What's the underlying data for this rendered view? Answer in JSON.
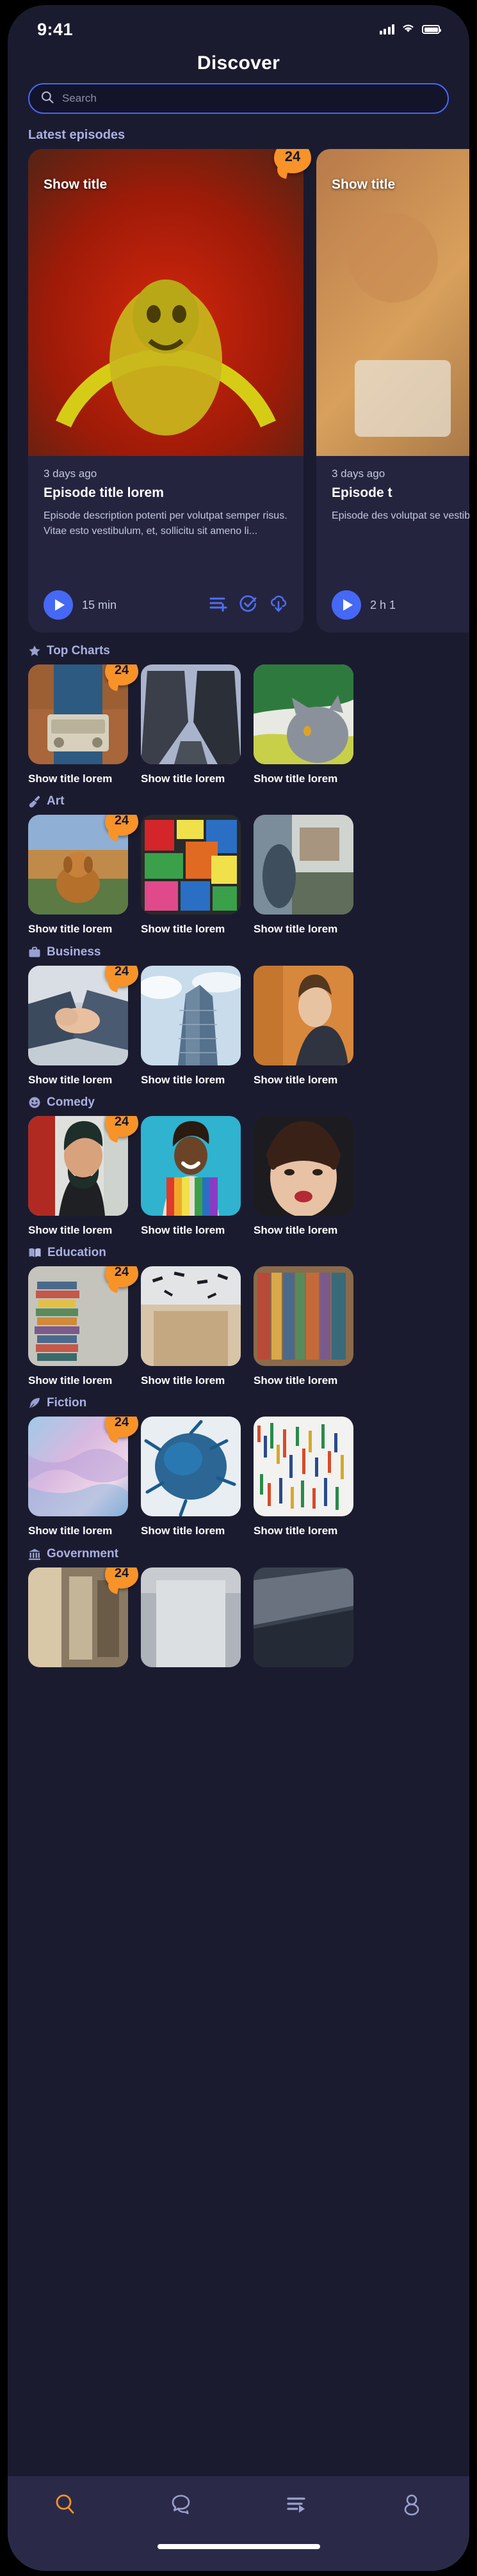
{
  "status_bar": {
    "time": "9:41",
    "icons": [
      "cellular-signal-icon",
      "wifi-icon",
      "battery-icon"
    ]
  },
  "header": {
    "title": "Discover"
  },
  "search": {
    "placeholder": "Search",
    "value": "",
    "icon": "search-icon",
    "border_color": "#4568f5"
  },
  "theme": {
    "background": "#1b1b30",
    "card_background": "#24243f",
    "accent_blue": "#4568f5",
    "accent_orange": "#f79328",
    "heading_color": "#aab0e0",
    "text_primary": "#ffffff",
    "text_secondary": "#c3c7de",
    "tabbar_background": "#2a2a48"
  },
  "latest_episodes": {
    "heading": "Latest episodes",
    "cards": [
      {
        "show_title": "Show title",
        "badge": "24",
        "date": "3 days ago",
        "episode_title": "Episode title lorem",
        "description": "Episode description potenti per volutpat semper risus. Vitae esto vestibulum, et, sollicitu sit ameno li...",
        "duration": "15 min",
        "actions": [
          "add-to-queue-icon",
          "mark-played-icon",
          "download-icon"
        ]
      },
      {
        "show_title": "Show title",
        "badge": "",
        "date": "3 days ago",
        "episode_title": "Episode t",
        "description": "Episode des volutpat se vestibulum,",
        "duration": "2 h 1",
        "actions": []
      }
    ]
  },
  "sections": [
    {
      "heading": "Top Charts",
      "icon": "star-icon",
      "items": [
        {
          "title": "Show title lorem",
          "badge": "24"
        },
        {
          "title": "Show title lorem",
          "badge": ""
        },
        {
          "title": "Show title lorem",
          "badge": ""
        }
      ]
    },
    {
      "heading": "Art",
      "icon": "paintbrush-icon",
      "items": [
        {
          "title": "Show title lorem",
          "badge": "24"
        },
        {
          "title": "Show title lorem",
          "badge": ""
        },
        {
          "title": "Show title lorem",
          "badge": ""
        }
      ]
    },
    {
      "heading": "Business",
      "icon": "briefcase-icon",
      "items": [
        {
          "title": "Show title lorem",
          "badge": "24"
        },
        {
          "title": "Show title lorem",
          "badge": ""
        },
        {
          "title": "Show title lorem",
          "badge": ""
        }
      ]
    },
    {
      "heading": "Comedy",
      "icon": "smiley-face-icon",
      "items": [
        {
          "title": "Show title lorem",
          "badge": "24"
        },
        {
          "title": "Show title lorem",
          "badge": ""
        },
        {
          "title": "Show title lorem",
          "badge": ""
        }
      ]
    },
    {
      "heading": "Education",
      "icon": "open-book-icon",
      "items": [
        {
          "title": "Show title lorem",
          "badge": "24"
        },
        {
          "title": "Show title lorem",
          "badge": ""
        },
        {
          "title": "Show title lorem",
          "badge": ""
        }
      ]
    },
    {
      "heading": "Fiction",
      "icon": "feather-pen-icon",
      "items": [
        {
          "title": "Show title lorem",
          "badge": "24"
        },
        {
          "title": "Show title lorem",
          "badge": ""
        },
        {
          "title": "Show title lorem",
          "badge": ""
        }
      ]
    },
    {
      "heading": "Government",
      "icon": "classical-building-icon",
      "items": [
        {
          "title": "",
          "badge": "24"
        },
        {
          "title": "",
          "badge": ""
        },
        {
          "title": "",
          "badge": ""
        }
      ]
    }
  ],
  "tabbar": {
    "items": [
      {
        "name": "discover-tab",
        "icon": "search-icon",
        "active": true
      },
      {
        "name": "conversations-tab",
        "icon": "chat-bubbles-icon",
        "active": false
      },
      {
        "name": "queue-tab",
        "icon": "playlist-play-icon",
        "active": false
      },
      {
        "name": "profile-tab",
        "icon": "person-icon",
        "active": false
      }
    ],
    "active_color": "#f79328",
    "inactive_color": "#9aa0cf"
  }
}
